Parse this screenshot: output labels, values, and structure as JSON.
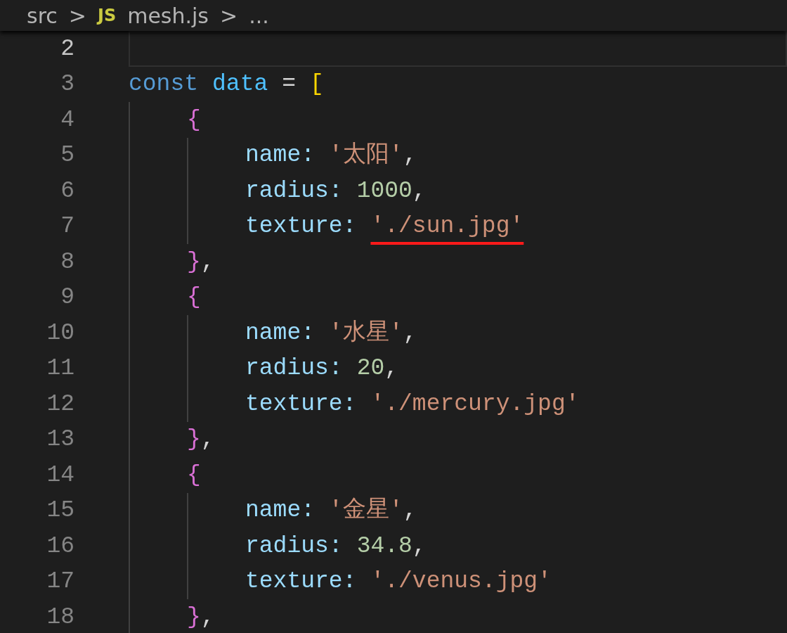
{
  "breadcrumb": {
    "folder": "src",
    "separator_1": ">",
    "file_icon": "JS",
    "file": "mesh.js",
    "separator_2": ">",
    "more": "..."
  },
  "lines": [
    {
      "number": "2",
      "current": true
    },
    {
      "number": "3",
      "current": false,
      "tokens": [
        {
          "kind": "keyword",
          "text": "const"
        },
        {
          "kind": "variable",
          "text": "data"
        },
        {
          "kind": "operator",
          "text": "="
        },
        {
          "kind": "bracket",
          "text": "["
        }
      ],
      "children": [
        {
          "number": "4",
          "current": false,
          "tokens": [
            {
              "kind": "brace",
              "text": "{"
            }
          ],
          "children": [
            {
              "number": "5",
              "current": false,
              "tokens": [
                {
                  "kind": "property",
                  "text": "name:"
                },
                {
                  "kind": "string",
                  "text": "'太阳'"
                },
                {
                  "kind": "operator",
                  "text": ","
                }
              ]
            },
            {
              "number": "6",
              "current": false,
              "tokens": [
                {
                  "kind": "property",
                  "text": "radius:"
                },
                {
                  "kind": "number",
                  "text": "1000"
                },
                {
                  "kind": "operator",
                  "text": ","
                }
              ]
            },
            {
              "number": "7",
              "current": false,
              "underlined": true,
              "tokens": [
                {
                  "kind": "property",
                  "text": "texture:"
                },
                {
                  "kind": "string",
                  "text": "'./sun.jpg'"
                }
              ]
            }
          ]
        },
        {
          "number": "8",
          "current": false,
          "tokens": [
            {
              "kind": "brace",
              "text": "}"
            },
            {
              "kind": "operator",
              "text": ","
            }
          ]
        },
        {
          "number": "9",
          "current": false,
          "tokens": [
            {
              "kind": "brace",
              "text": "{"
            }
          ],
          "children": [
            {
              "number": "10",
              "current": false,
              "tokens": [
                {
                  "kind": "property",
                  "text": "name:"
                },
                {
                  "kind": "string",
                  "text": "'水星'"
                },
                {
                  "kind": "operator",
                  "text": ","
                }
              ]
            },
            {
              "number": "11",
              "current": false,
              "tokens": [
                {
                  "kind": "property",
                  "text": "radius:"
                },
                {
                  "kind": "number",
                  "text": "20"
                },
                {
                  "kind": "operator",
                  "text": ","
                }
              ]
            },
            {
              "number": "12",
              "current": false,
              "tokens": [
                {
                  "kind": "property",
                  "text": "texture:"
                },
                {
                  "kind": "string",
                  "text": "'./mercury.jpg'"
                }
              ]
            }
          ]
        },
        {
          "number": "13",
          "current": false,
          "tokens": [
            {
              "kind": "brace",
              "text": "}"
            },
            {
              "kind": "operator",
              "text": ","
            }
          ]
        },
        {
          "number": "14",
          "current": false,
          "tokens": [
            {
              "kind": "brace",
              "text": "{"
            }
          ],
          "children": [
            {
              "number": "15",
              "current": false,
              "tokens": [
                {
                  "kind": "property",
                  "text": "name:"
                },
                {
                  "kind": "string",
                  "text": "'金星'"
                },
                {
                  "kind": "operator",
                  "text": ","
                }
              ]
            },
            {
              "number": "16",
              "current": false,
              "tokens": [
                {
                  "kind": "property",
                  "text": "radius:"
                },
                {
                  "kind": "number",
                  "text": "34.8"
                },
                {
                  "kind": "operator",
                  "text": ","
                }
              ]
            },
            {
              "number": "17",
              "current": false,
              "tokens": [
                {
                  "kind": "property",
                  "text": "texture:"
                },
                {
                  "kind": "string",
                  "text": "'./venus.jpg'"
                }
              ]
            }
          ]
        },
        {
          "number": "18",
          "current": false,
          "tokens": [
            {
              "kind": "brace",
              "text": "}"
            },
            {
              "kind": "operator",
              "text": ","
            }
          ]
        }
      ]
    }
  ]
}
